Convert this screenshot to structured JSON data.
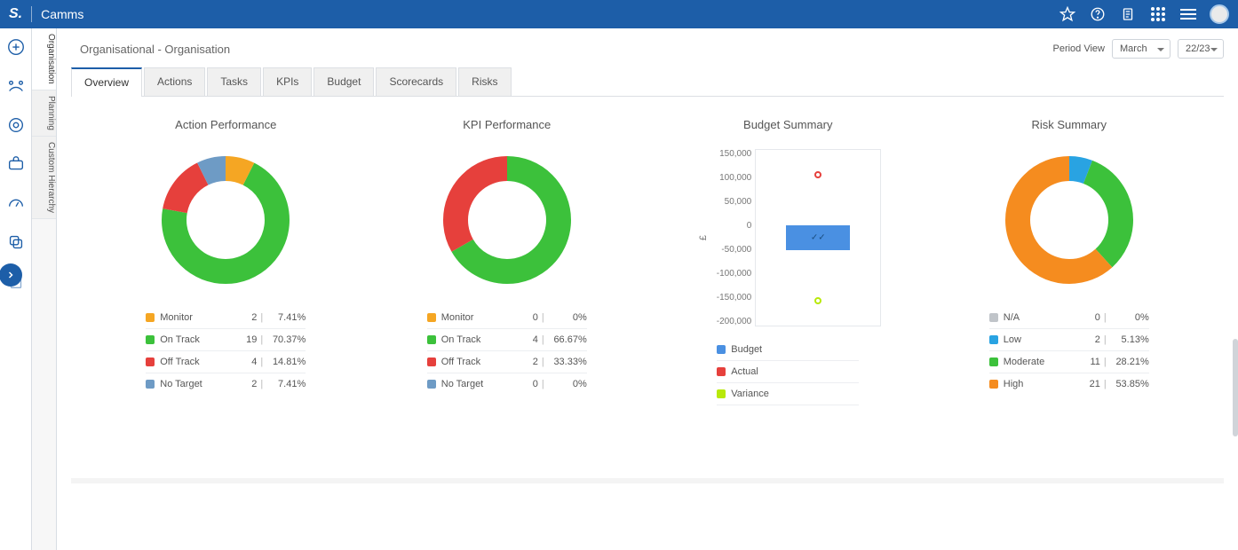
{
  "header": {
    "logo_text": "S.",
    "app_title": "Camms"
  },
  "left_rail": {
    "expand_label": "›"
  },
  "v_tabs": [
    "Organisation",
    "Planning",
    "Custom Hierarchy"
  ],
  "v_tab_active_index": 0,
  "breadcrumb": "Organisational - Organisation",
  "period": {
    "label": "Period View",
    "month": "March",
    "year": "22/23"
  },
  "tabs": [
    "Overview",
    "Actions",
    "Tasks",
    "KPIs",
    "Budget",
    "Scorecards",
    "Risks"
  ],
  "tab_active_index": 0,
  "colors": {
    "monitor": "#f5a623",
    "on_track": "#3cc13b",
    "off_track": "#e6403c",
    "no_target": "#6e9bc5",
    "na": "#c0c4c9",
    "low": "#29a3e2",
    "moderate": "#3cc13b",
    "high": "#f58c1f",
    "budget": "#4a90e2",
    "actual": "#e6403c",
    "variance": "#b8e909"
  },
  "card_action": {
    "title": "Action Performance",
    "items": [
      {
        "label": "Monitor",
        "count": 2,
        "pct": "7.41%",
        "color": "#f5a623"
      },
      {
        "label": "On Track",
        "count": 19,
        "pct": "70.37%",
        "color": "#3cc13b"
      },
      {
        "label": "Off Track",
        "count": 4,
        "pct": "14.81%",
        "color": "#e6403c"
      },
      {
        "label": "No Target",
        "count": 2,
        "pct": "7.41%",
        "color": "#6e9bc5"
      }
    ]
  },
  "card_kpi": {
    "title": "KPI Performance",
    "items": [
      {
        "label": "Monitor",
        "count": 0,
        "pct": "0%",
        "color": "#f5a623"
      },
      {
        "label": "On Track",
        "count": 4,
        "pct": "66.67%",
        "color": "#3cc13b"
      },
      {
        "label": "Off Track",
        "count": 2,
        "pct": "33.33%",
        "color": "#e6403c"
      },
      {
        "label": "No Target",
        "count": 0,
        "pct": "0%",
        "color": "#6e9bc5"
      }
    ]
  },
  "card_budget": {
    "title": "Budget Summary",
    "ylabel": "£",
    "y_ticks": [
      "150,000",
      "100,000",
      "50,000",
      "0",
      "-50,000",
      "-100,000",
      "-150,000",
      "-200,000"
    ],
    "legend": [
      {
        "label": "Budget",
        "color": "#4a90e2"
      },
      {
        "label": "Actual",
        "color": "#e6403c"
      },
      {
        "label": "Variance",
        "color": "#b8e909"
      }
    ]
  },
  "card_risk": {
    "title": "Risk Summary",
    "items": [
      {
        "label": "N/A",
        "count": 0,
        "pct": "0%",
        "color": "#c0c4c9"
      },
      {
        "label": "Low",
        "count": 2,
        "pct": "5.13%",
        "color": "#29a3e2"
      },
      {
        "label": "Moderate",
        "count": 11,
        "pct": "28.21%",
        "color": "#3cc13b"
      },
      {
        "label": "High",
        "count": 21,
        "pct": "53.85%",
        "color": "#f58c1f"
      }
    ]
  },
  "chart_data": [
    {
      "type": "pie",
      "title": "Action Performance",
      "categories": [
        "Monitor",
        "On Track",
        "Off Track",
        "No Target"
      ],
      "values": [
        2,
        19,
        4,
        2
      ],
      "percentages": [
        7.41,
        70.37,
        14.81,
        7.41
      ]
    },
    {
      "type": "pie",
      "title": "KPI Performance",
      "categories": [
        "Monitor",
        "On Track",
        "Off Track",
        "No Target"
      ],
      "values": [
        0,
        4,
        2,
        0
      ],
      "percentages": [
        0,
        66.67,
        33.33,
        0
      ]
    },
    {
      "type": "bar",
      "title": "Budget Summary",
      "ylabel": "£",
      "ylim": [
        -200000,
        150000
      ],
      "series": [
        {
          "name": "Budget",
          "values": [
            -50000
          ]
        },
        {
          "name": "Actual",
          "values": [
            100000
          ]
        },
        {
          "name": "Variance",
          "values": [
            -150000
          ]
        }
      ]
    },
    {
      "type": "pie",
      "title": "Risk Summary",
      "categories": [
        "N/A",
        "Low",
        "Moderate",
        "High"
      ],
      "values": [
        0,
        2,
        11,
        21
      ],
      "percentages": [
        0,
        5.13,
        28.21,
        53.85
      ]
    }
  ]
}
